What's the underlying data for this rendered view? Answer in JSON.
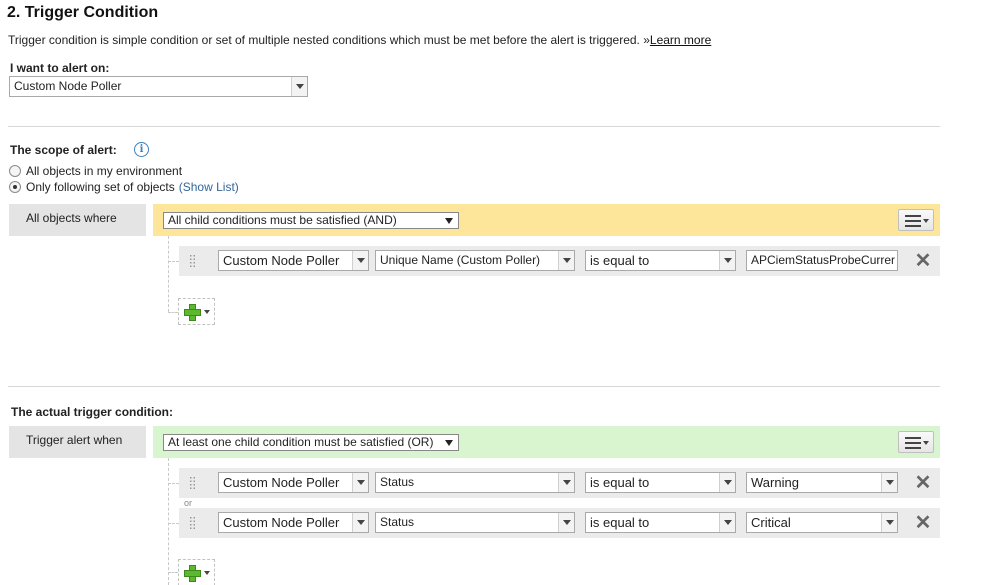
{
  "section": {
    "title": "2. Trigger Condition",
    "description": "Trigger condition is simple condition or set of multiple nested conditions which must be met before the alert is triggered.",
    "learn_more_prefix": "»",
    "learn_more": "Learn more"
  },
  "alert_on": {
    "label": "I want to alert on:",
    "value": "Custom Node Poller"
  },
  "scope": {
    "label": "The scope of alert:",
    "info_icon": "info-icon",
    "options": [
      {
        "label": "All objects in my environment",
        "selected": false
      },
      {
        "label": "Only following set of objects",
        "selected": true,
        "link": "(Show List)"
      }
    ],
    "side_label": "All objects where",
    "group_select": "All child conditions must be satisfied (AND)",
    "conditions": [
      {
        "object": "Custom Node Poller",
        "field": "Unique Name (Custom Poller)",
        "operator": "is equal to",
        "value": "APCiemStatusProbeCurrer"
      }
    ]
  },
  "trigger": {
    "label": "The actual trigger condition:",
    "side_label": "Trigger alert when",
    "group_select": "At least one child condition must be satisfied (OR)",
    "connector": "or",
    "conditions": [
      {
        "object": "Custom Node Poller",
        "field": "Status",
        "operator": "is equal to",
        "value": "Warning"
      },
      {
        "object": "Custom Node Poller",
        "field": "Status",
        "operator": "is equal to",
        "value": "Critical"
      }
    ]
  },
  "colors": {
    "and_band": "#fde59a",
    "or_band": "#d9f5cf",
    "link": "#336699",
    "add_icon": "#5cb82e"
  }
}
